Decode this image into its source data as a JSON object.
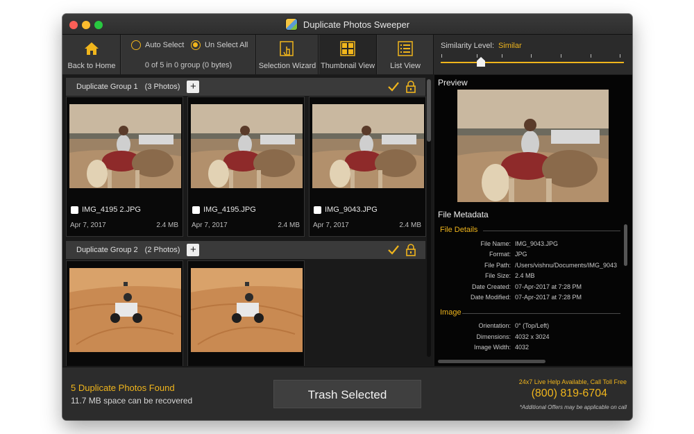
{
  "window": {
    "title": "Duplicate Photos Sweeper"
  },
  "toolbar": {
    "back_home_label": "Back to Home",
    "auto_select_label": "Auto Select",
    "unselect_all_label": "Un Select All",
    "selection_status": "0 of 5 in 0 group (0 bytes)",
    "selection_wizard_label": "Selection Wizard",
    "thumbnail_view_label": "Thumbnail View",
    "list_view_label": "List View",
    "similarity_label": "Similarity Level:",
    "similarity_value": "Similar",
    "similarity_level_fraction": 0.22
  },
  "groups": [
    {
      "title": "Duplicate Group 1",
      "count": "(3 Photos)",
      "photos": [
        {
          "name": "IMG_4195 2.JPG",
          "date": "Apr 7, 2017",
          "size": "2.4 MB",
          "checked": false
        },
        {
          "name": "IMG_4195.JPG",
          "date": "Apr 7, 2017",
          "size": "2.4 MB",
          "checked": false
        },
        {
          "name": "IMG_9043.JPG",
          "date": "Apr 7, 2017",
          "size": "2.4 MB",
          "checked": false
        }
      ]
    },
    {
      "title": "Duplicate Group 2",
      "count": "(2 Photos)",
      "photos": [
        {
          "name": "",
          "date": "",
          "size": "",
          "checked": false
        },
        {
          "name": "",
          "date": "",
          "size": "",
          "checked": false
        }
      ]
    }
  ],
  "preview": {
    "label": "Preview",
    "metadata_label": "File Metadata",
    "file_details_label": "File Details",
    "file_details": [
      {
        "key": "File Name:",
        "value": "IMG_9043.JPG"
      },
      {
        "key": "Format:",
        "value": "JPG"
      },
      {
        "key": "File Path:",
        "value": "/Users/vishnu/Documents/IMG_9043"
      },
      {
        "key": "File Size:",
        "value": "2.4 MB"
      },
      {
        "key": "Date Created:",
        "value": "07-Apr-2017 at 7:28 PM"
      },
      {
        "key": "Date Modified:",
        "value": "07-Apr-2017 at 7:28 PM"
      }
    ],
    "image_label": "Image",
    "image_details": [
      {
        "key": "Orientation:",
        "value": "0° (Top/Left)"
      },
      {
        "key": "Dimensions:",
        "value": "4032 x 3024"
      },
      {
        "key": "Image Width:",
        "value": "4032"
      }
    ]
  },
  "footer": {
    "found_text": "5 Duplicate Photos Found",
    "recover_text": "11.7 MB space can be recovered",
    "trash_button": "Trash Selected",
    "help_text": "24x7 Live Help Available, Call Toll Free",
    "phone": "(800) 819-6704",
    "offers_text": "*Additional Offers may be applicable on call"
  },
  "colors": {
    "accent": "#f0b51c",
    "background": "#1c1c1c",
    "panel": "#343434"
  }
}
